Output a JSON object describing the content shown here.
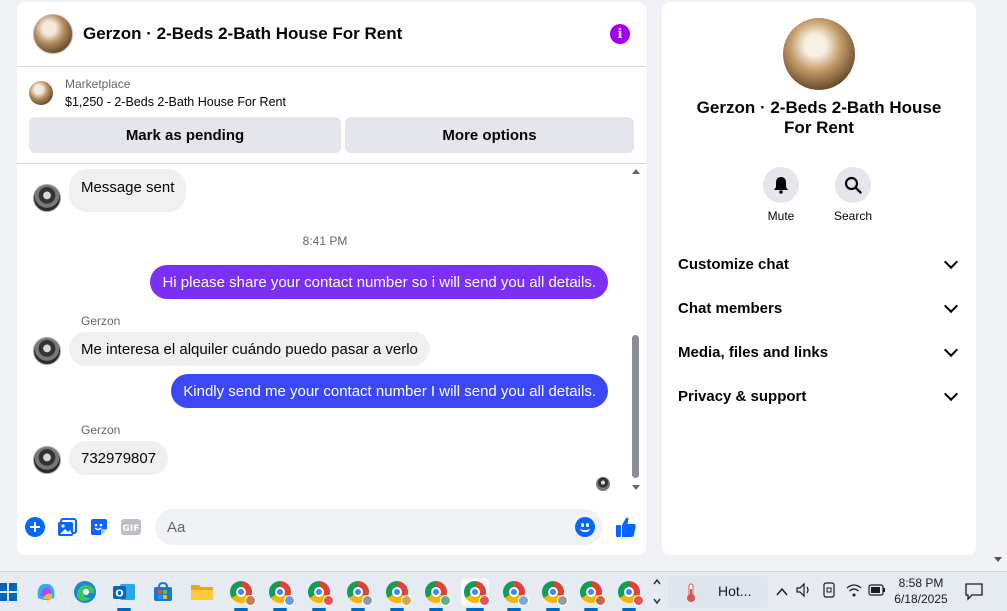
{
  "chat": {
    "title": "Gerzon · 2-Beds 2-Bath House For Rent",
    "marketplace_label": "Marketplace",
    "listing": "$1,250 - 2-Beds 2-Bath House For Rent",
    "mark_pending": "Mark as pending",
    "more_options": "More options",
    "messages": {
      "m1": "Message sent",
      "time": "8:41 PM",
      "m2": "Hi please share your contact number so i will send you all details.",
      "sender1": "Gerzon",
      "m3": "Me interesa el alquiler cuándo puedo pasar a verlo",
      "m4": "Kindly send me your contact number I will send you all details.",
      "sender2": "Gerzon",
      "m5": "732979807"
    },
    "composer_placeholder": "Aa",
    "colors": {
      "outgoing_1": "#7b2ff7",
      "outgoing_2": "#3a48f5",
      "accent": "#0866ff",
      "info": "#a100f2"
    }
  },
  "info_panel": {
    "title": "Gerzon · 2-Beds 2-Bath House For Rent",
    "mute": "Mute",
    "search": "Search",
    "sections": [
      "Customize chat",
      "Chat members",
      "Media, files and links",
      "Privacy & support"
    ]
  },
  "taskbar": {
    "weather": "Hot...",
    "time": "8:58 PM",
    "date": "6/18/2025",
    "apps": [
      "copilot-icon",
      "edge-icon",
      "outlook-icon",
      "store-icon",
      "file-explorer-icon",
      "chrome-icon"
    ]
  }
}
